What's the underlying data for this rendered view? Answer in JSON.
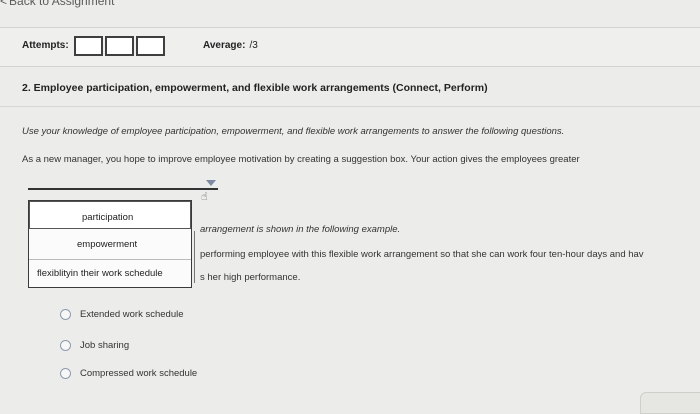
{
  "nav": {
    "back_label": "Back to Assignment"
  },
  "attempts": {
    "label": "Attempts:",
    "average_label": "Average:",
    "average_value": "/3"
  },
  "question": {
    "title": "2. Employee participation, empowerment, and flexible work arrangements (Connect, Perform)",
    "instructions": "Use your knowledge of employee participation, empowerment, and flexible work arrangements to answer the following questions.",
    "prompt": "As a new manager, you hope to improve employee motivation by creating a suggestion box. Your action gives the employees greater"
  },
  "dropdown": {
    "options": [
      "participation",
      "empowerment",
      "flexiblityin their work schedule"
    ]
  },
  "example_lines": {
    "line1": "arrangement is shown in the following example.",
    "line2": "performing employee with this flexible work arrangement so that she can work four ten-hour days and hav",
    "line3": "s her high performance."
  },
  "choices": [
    "Extended work schedule",
    "Job sharing",
    "Compressed work schedule"
  ],
  "icons": {
    "back": "chevron-left-icon",
    "dropdown": "caret-down-icon",
    "pointer": "hand-pointer-icon"
  }
}
